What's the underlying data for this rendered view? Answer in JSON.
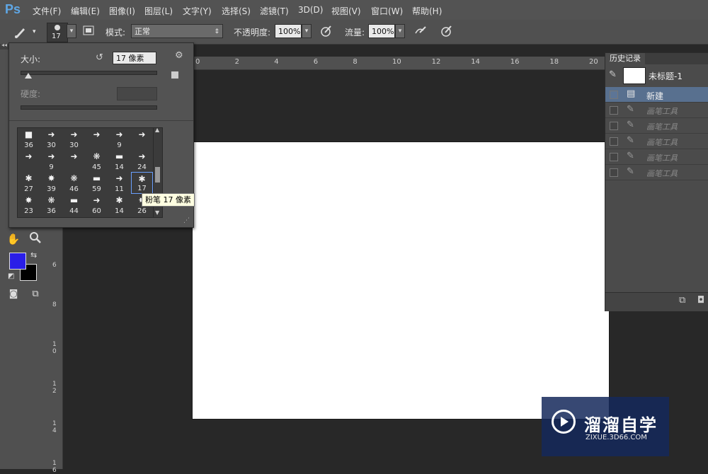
{
  "app": {
    "logo": "Ps"
  },
  "menu": [
    "文件(F)",
    "编辑(E)",
    "图像(I)",
    "图层(L)",
    "文字(Y)",
    "选择(S)",
    "滤镜(T)",
    "3D(D)",
    "视图(V)",
    "窗口(W)",
    "帮助(H)"
  ],
  "options": {
    "brush_size_badge": "17",
    "mode_label": "模式:",
    "mode_value": "正常",
    "opacity_label": "不透明度:",
    "opacity_value": "100%",
    "flow_label": "流量:",
    "flow_value": "100%"
  },
  "brush_panel": {
    "size_label": "大小:",
    "size_value": "17 像素",
    "hardness_label": "硬度:",
    "size_fraction": 0.06,
    "brushes": [
      [
        "36",
        "30",
        "30",
        "",
        "9",
        ""
      ],
      [
        "",
        "9",
        "",
        "45",
        "14",
        "24"
      ],
      [
        "27",
        "39",
        "46",
        "59",
        "11",
        "17"
      ],
      [
        "23",
        "36",
        "44",
        "60",
        "14",
        "26"
      ]
    ],
    "selected_index": [
      2,
      5
    ],
    "tooltip": "粉笔 17 像素"
  },
  "rulers": {
    "h": [
      "0",
      "2",
      "4",
      "6",
      "8",
      "10",
      "12",
      "14",
      "16",
      "18",
      "20"
    ],
    "v": [
      "6",
      "8",
      "1\n0",
      "1\n2",
      "1\n4",
      "1\n6"
    ]
  },
  "colors": {
    "foreground": "#2a1ee8",
    "background": "#000000"
  },
  "history": {
    "tab": "历史记录",
    "snapshot": "未标题-1",
    "items": [
      {
        "label": "新建",
        "active": true
      },
      {
        "label": "画笔工具",
        "active": false
      },
      {
        "label": "画笔工具",
        "active": false
      },
      {
        "label": "画笔工具",
        "active": false
      },
      {
        "label": "画笔工具",
        "active": false
      },
      {
        "label": "画笔工具",
        "active": false
      }
    ]
  },
  "watermark": {
    "name": "溜溜自学",
    "url": "ZIXUE.3D66.COM"
  }
}
